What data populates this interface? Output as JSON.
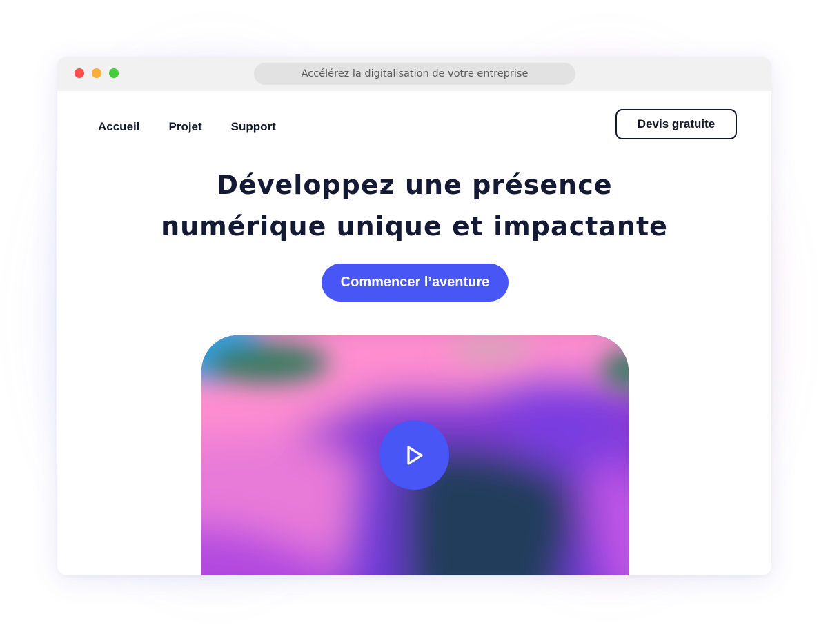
{
  "window": {
    "url_title": "Accélérez la digitalisation de votre entreprise",
    "controls": [
      "close",
      "minimize",
      "maximize"
    ]
  },
  "nav": {
    "links": [
      {
        "label": "Accueil"
      },
      {
        "label": "Projet"
      },
      {
        "label": "Support"
      }
    ],
    "quote_button": "Devis gratuite"
  },
  "hero": {
    "title_line1": "Développez une présence",
    "title_line2": "numérique unique et impactante",
    "cta_label": "Commencer l’aventure"
  },
  "media": {
    "play_icon": "play-icon"
  },
  "colors": {
    "accent": "#4856f6",
    "text_dark": "#141a33",
    "titlebar": "#f1f1f1",
    "dot_red": "#fe4f4f",
    "dot_yellow": "#fcad3b",
    "dot_green": "#44cd3a"
  }
}
